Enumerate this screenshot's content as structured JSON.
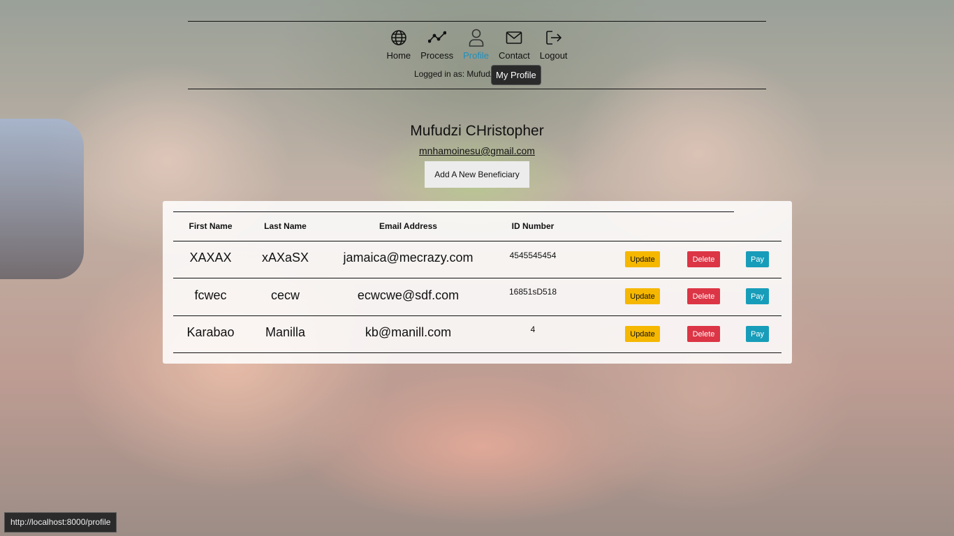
{
  "nav": {
    "items": [
      {
        "label": "Home",
        "icon": "globe-icon"
      },
      {
        "label": "Process",
        "icon": "chart-line-icon"
      },
      {
        "label": "Profile",
        "icon": "user-icon"
      },
      {
        "label": "Contact",
        "icon": "envelope-icon"
      },
      {
        "label": "Logout",
        "icon": "logout-icon"
      }
    ],
    "active": "Profile",
    "logged_in_text": "Logged in as: Mufudz",
    "tooltip": "My  Profile"
  },
  "profile": {
    "name": "Mufudzi CHristopher",
    "email": "mnhamoinesu@gmail.com",
    "add_button": "Add A New Beneficiary"
  },
  "table": {
    "headers": [
      "First Name",
      "Last Name",
      "Email Address",
      "ID Number"
    ],
    "rows": [
      {
        "first": "XAXAX",
        "last": "xAXaSX",
        "email": "jamaica@mecrazy.com",
        "id": "4545545454"
      },
      {
        "first": "fcwec",
        "last": "cecw",
        "email": "ecwcwe@sdf.com",
        "id": "16851sD518"
      },
      {
        "first": "Karabao",
        "last": "Manilla",
        "email": "kb@manill.com",
        "id": "4"
      }
    ],
    "update_label": "Update",
    "delete_label": "Delete",
    "pay_label": "Pay"
  },
  "colors": {
    "active_nav": "#1e8fbe",
    "update": "#f5b700",
    "delete": "#dc3545",
    "pay": "#179db9"
  },
  "statusbar": "http://localhost:8000/profile"
}
